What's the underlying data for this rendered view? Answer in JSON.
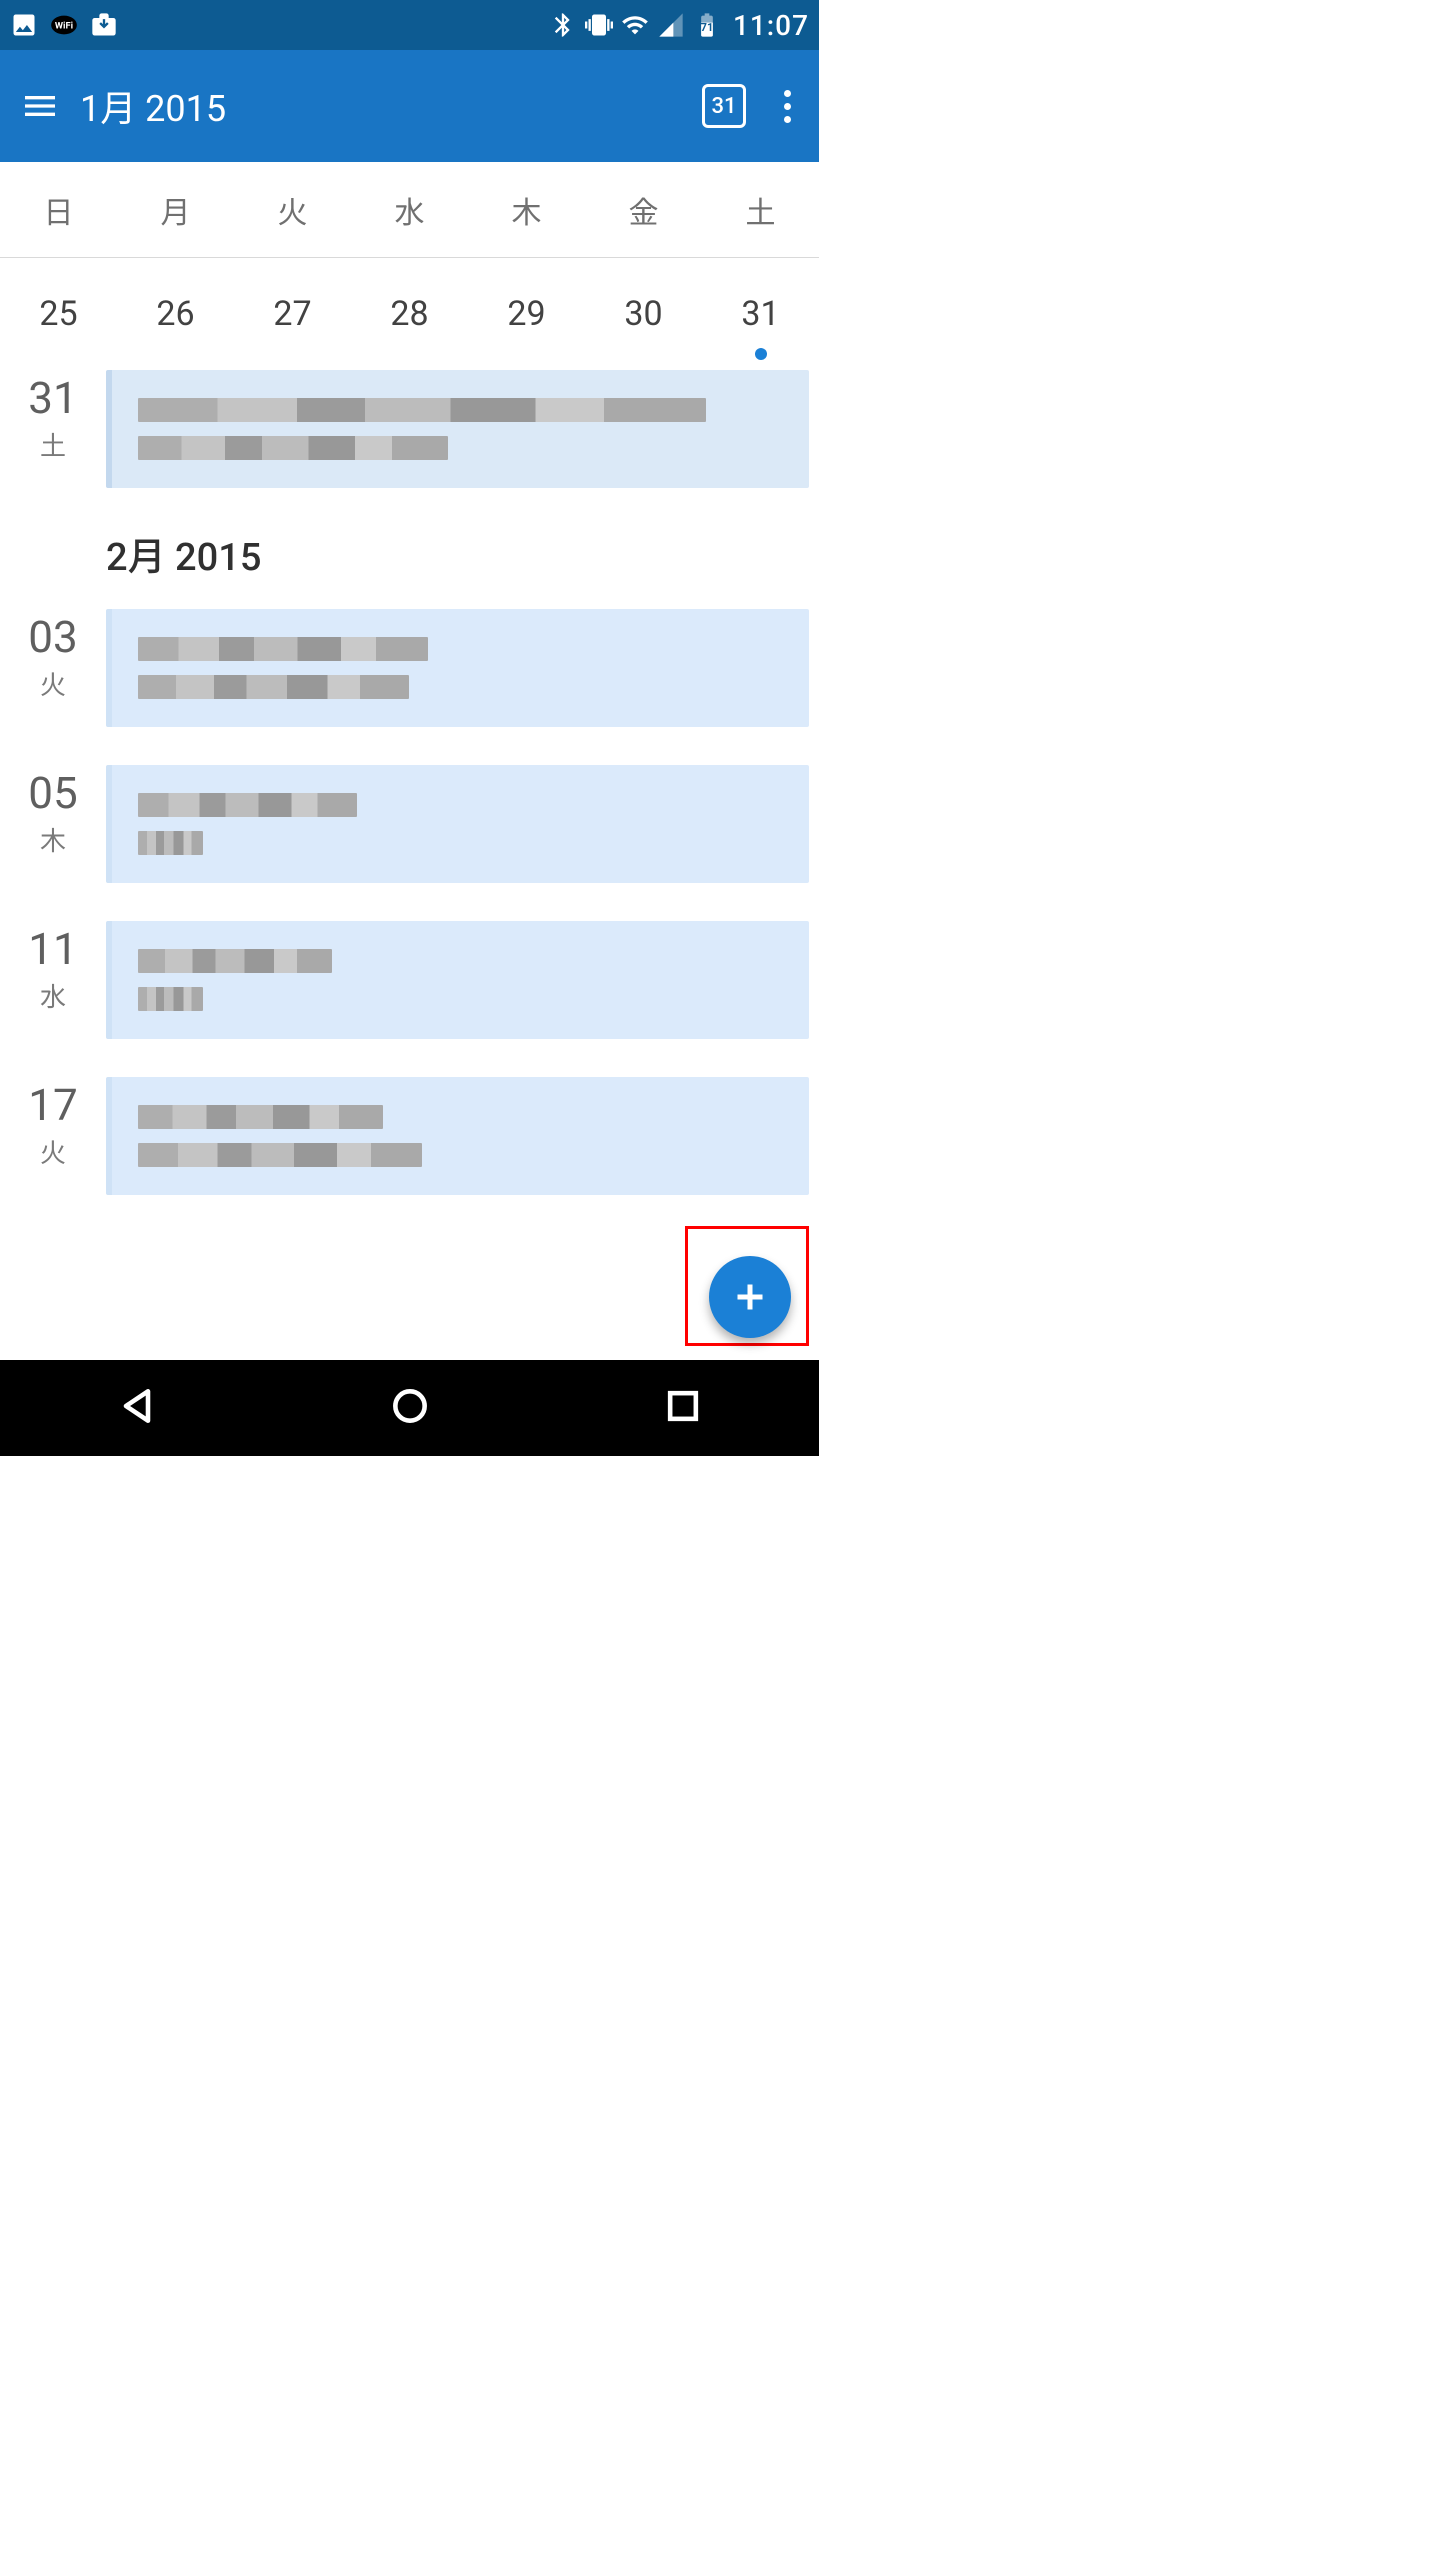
{
  "status": {
    "clock": "11:07",
    "battery_pct": "71"
  },
  "toolbar": {
    "title": "1月 2015",
    "today_chip": "31"
  },
  "weekdays": [
    "日",
    "月",
    "火",
    "水",
    "木",
    "金",
    "土"
  ],
  "date_strip": [
    "25",
    "26",
    "27",
    "28",
    "29",
    "30",
    "31"
  ],
  "date_strip_marked_index": 6,
  "agenda": [
    {
      "day_num": "31",
      "day_dow": "土",
      "censor": [
        "long",
        "med"
      ]
    }
  ],
  "month_separator": "2月 2015",
  "agenda_feb": [
    {
      "day_num": "03",
      "day_dow": "火",
      "censor": [
        "med",
        "med"
      ]
    },
    {
      "day_num": "05",
      "day_dow": "木",
      "censor": [
        "med",
        "short"
      ]
    },
    {
      "day_num": "11",
      "day_dow": "水",
      "censor": [
        "short",
        "short"
      ]
    },
    {
      "day_num": "17",
      "day_dow": "火",
      "censor": [
        "med",
        "med"
      ]
    }
  ]
}
